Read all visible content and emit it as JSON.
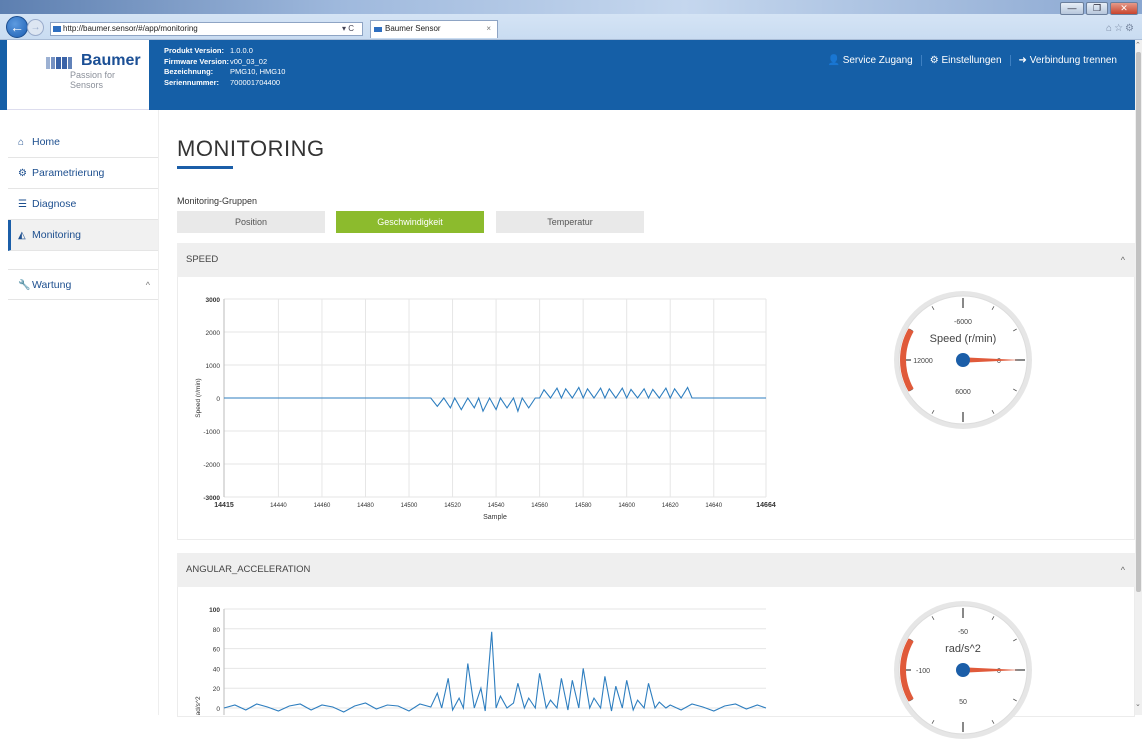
{
  "browser": {
    "url": "http://baumer.sensor/#/app/monitoring",
    "tab_title": "Baumer Sensor",
    "addr_controls": "▾ C",
    "tab_close": "×",
    "window_buttons": [
      "—",
      "❐",
      "✕"
    ],
    "icons": [
      "home-icon",
      "star-icon",
      "gear-icon"
    ]
  },
  "header": {
    "brand": "Baumer",
    "tagline": "Passion for Sensors",
    "info": [
      {
        "key": "Produkt Version:",
        "value": "1.0.0.0"
      },
      {
        "key": "Firmware Version:",
        "value": "v00_03_02"
      },
      {
        "key": "Bezeichnung:",
        "value": "PMG10, HMG10"
      },
      {
        "key": "Seriennummer:",
        "value": "700001704400"
      }
    ],
    "nav": [
      {
        "icon": "user-icon",
        "label": "Service Zugang"
      },
      {
        "icon": "gear-icon",
        "label": "Einstellungen"
      },
      {
        "icon": "sign-out-icon",
        "label": "Verbindung trennen"
      }
    ]
  },
  "sidebar": {
    "items": [
      {
        "icon": "home-icon",
        "label": "Home",
        "active": false
      },
      {
        "icon": "cogs-icon",
        "label": "Parametrierung",
        "active": false
      },
      {
        "icon": "list-icon",
        "label": "Diagnose",
        "active": false
      },
      {
        "icon": "area-chart-icon",
        "label": "Monitoring",
        "active": true
      },
      {
        "icon": "wrench-icon",
        "label": "Wartung",
        "active": false,
        "chevron": "^"
      }
    ]
  },
  "main": {
    "title": "MONITORING",
    "group_label": "Monitoring-Gruppen",
    "groups": [
      {
        "label": "Position",
        "active": false
      },
      {
        "label": "Geschwindigkeit",
        "active": true
      },
      {
        "label": "Temperatur",
        "active": false
      }
    ]
  },
  "colors": {
    "primary": "#155fa7",
    "accent_green": "#8cbb2d",
    "series_line": "#2e7ebf",
    "gauge_needle": "#e05a3a",
    "gauge_hub": "#1b5ea8"
  },
  "panels": [
    {
      "title": "SPEED",
      "collapse": "^",
      "gauge": {
        "label": "Speed (r/min)",
        "top": "-6000",
        "left": "12000",
        "bottom": "6000",
        "right": "0",
        "needle_value": 0
      }
    },
    {
      "title": "ANGULAR_ACCELERATION",
      "collapse": "^",
      "gauge": {
        "label": "rad/s^2",
        "top": "-50",
        "left": "-100",
        "bottom": "50",
        "right": "0",
        "needle_value": 0
      }
    }
  ],
  "chart_data": [
    {
      "type": "line",
      "title": "",
      "xlabel": "Sample",
      "ylabel": "Speed (r/min)",
      "xlim": [
        14415,
        14664
      ],
      "ylim": [
        -3000,
        3000
      ],
      "x_ticks": [
        "14415",
        "14440",
        "14460",
        "14480",
        "14500",
        "14520",
        "14540",
        "14560",
        "14580",
        "14600",
        "14620",
        "14640",
        "14664"
      ],
      "y_ticks": [
        "3000",
        "2000",
        "1000",
        "0",
        "-1000",
        "-2000",
        "-3000"
      ],
      "grid": true,
      "series": [
        {
          "x": [
            14415,
            14510,
            14513,
            14516,
            14519,
            14521,
            14524,
            14527,
            14530,
            14532,
            14534,
            14537,
            14540,
            14542,
            14545,
            14548,
            14550,
            14552,
            14555,
            14558,
            14560,
            14562,
            14565,
            14568,
            14570,
            14572,
            14575,
            14578,
            14580,
            14582,
            14585,
            14588,
            14590,
            14592,
            14595,
            14598,
            14600,
            14602,
            14605,
            14608,
            14610,
            14612,
            14615,
            14618,
            14620,
            14622,
            14625,
            14628,
            14630,
            14664
          ],
          "y": [
            0,
            0,
            -250,
            0,
            -300,
            0,
            -350,
            0,
            -300,
            0,
            -400,
            0,
            -350,
            0,
            -300,
            0,
            -400,
            0,
            -300,
            0,
            0,
            250,
            0,
            300,
            0,
            280,
            0,
            320,
            0,
            280,
            0,
            300,
            0,
            280,
            0,
            300,
            0,
            260,
            0,
            280,
            0,
            260,
            0,
            300,
            0,
            280,
            0,
            320,
            0,
            0
          ]
        }
      ]
    },
    {
      "type": "line",
      "title": "",
      "xlabel": "",
      "ylabel": "rad/s^2",
      "xlim": [
        14415,
        14664
      ],
      "ylim": [
        -100,
        100
      ],
      "y_ticks": [
        "100",
        "80",
        "60",
        "40",
        "20",
        "0"
      ],
      "grid": true,
      "series": [
        {
          "x": [
            14415,
            14420,
            14425,
            14430,
            14435,
            14440,
            14445,
            14450,
            14455,
            14460,
            14465,
            14470,
            14475,
            14480,
            14485,
            14490,
            14495,
            14500,
            14505,
            14510,
            14513,
            14515,
            14518,
            14520,
            14523,
            14525,
            14527,
            14530,
            14533,
            14535,
            14538,
            14540,
            14542,
            14545,
            14548,
            14550,
            14553,
            14555,
            14558,
            14560,
            14563,
            14565,
            14568,
            14570,
            14573,
            14575,
            14578,
            14580,
            14583,
            14585,
            14588,
            14590,
            14593,
            14595,
            14598,
            14600,
            14603,
            14605,
            14608,
            14610,
            14613,
            14615,
            14618,
            14620,
            14625,
            14630,
            14635,
            14640,
            14645,
            14650,
            14655,
            14660,
            14664
          ],
          "y": [
            0,
            3,
            -2,
            4,
            1,
            -3,
            2,
            4,
            -2,
            3,
            1,
            -4,
            2,
            5,
            -1,
            3,
            2,
            -3,
            4,
            1,
            15,
            0,
            30,
            -2,
            10,
            0,
            45,
            0,
            20,
            -3,
            77,
            0,
            12,
            0,
            5,
            25,
            0,
            10,
            0,
            35,
            0,
            8,
            0,
            30,
            -2,
            28,
            0,
            40,
            0,
            10,
            0,
            32,
            -3,
            22,
            0,
            28,
            -2,
            8,
            0,
            25,
            0,
            6,
            0,
            3,
            -2,
            4,
            1,
            -3,
            2,
            4,
            -1,
            3,
            0
          ]
        }
      ]
    }
  ]
}
